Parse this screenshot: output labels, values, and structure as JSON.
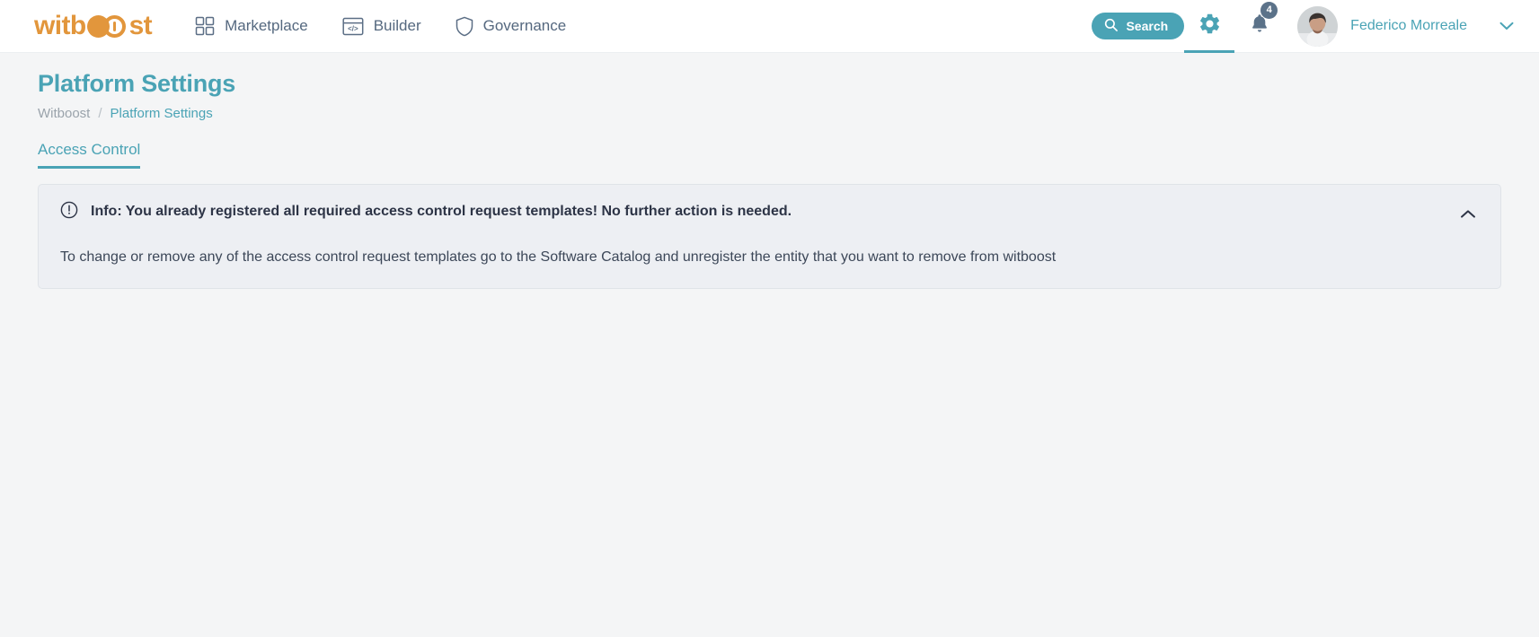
{
  "header": {
    "logo": {
      "text_before": "witb",
      "text_after": "st",
      "alt": "witboost"
    },
    "nav": [
      {
        "label": "Marketplace",
        "icon": "grid-icon"
      },
      {
        "label": "Builder",
        "icon": "code-window-icon"
      },
      {
        "label": "Governance",
        "icon": "shield-icon"
      }
    ],
    "search": {
      "label": "Search",
      "icon": "search-icon"
    },
    "settings": {
      "icon": "gear-icon",
      "active": true
    },
    "notifications": {
      "icon": "bell-icon",
      "count": "4"
    },
    "user": {
      "name": "Federico Morreale",
      "caret": "chevron-down-icon"
    }
  },
  "page": {
    "title": "Platform Settings",
    "breadcrumb": {
      "root": "Witboost",
      "separator": "/",
      "current": "Platform Settings"
    },
    "tabs": [
      {
        "label": "Access Control",
        "selected": true
      }
    ]
  },
  "alert": {
    "icon": "info-circle-icon",
    "title": "Info: You already registered all required access control request templates! No further action is needed.",
    "body": "To change or remove any of the access control request templates go to the Software Catalog and unregister the entity that you want to remove from witboost",
    "toggle_icon": "chevron-up-icon"
  },
  "colors": {
    "brand_orange": "#E2963C",
    "accent_teal": "#4AA3B5",
    "nav_text": "#55687F",
    "alert_bg": "#EDEFF3",
    "page_bg": "#F4F5F6"
  }
}
